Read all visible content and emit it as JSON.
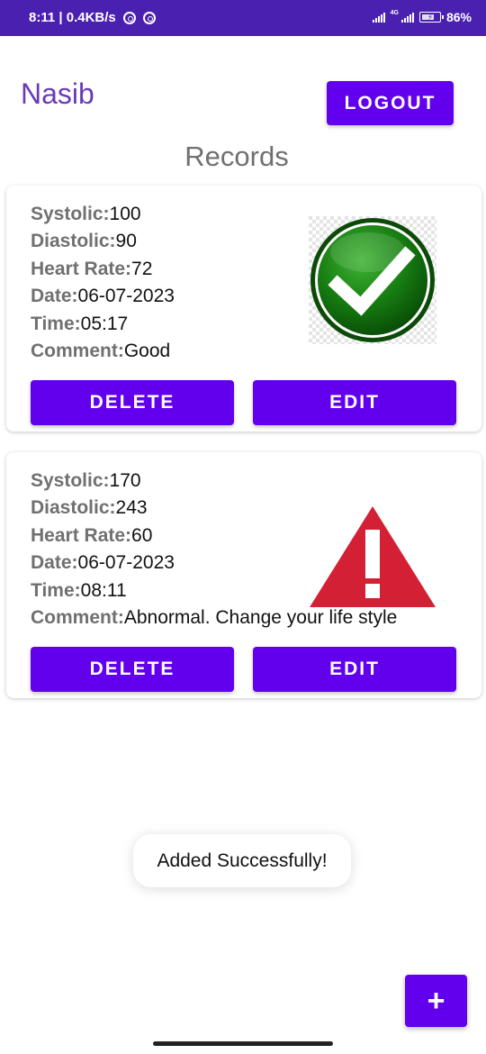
{
  "status_bar": {
    "time_speed": "8:11 | 0.4KB/s",
    "network": "4G",
    "battery": "86%"
  },
  "header": {
    "user_name": "Nasib",
    "logout_label": "LOGOUT"
  },
  "records_title": "Records",
  "records": [
    {
      "systolic_label": "Systolic:",
      "systolic": "100",
      "diastolic_label": "Diastolic:",
      "diastolic": "90",
      "heart_rate_label": "Heart Rate:",
      "heart_rate": "72",
      "date_label": "Date:",
      "date": "06-07-2023",
      "time_label": "Time:",
      "time": "05:17",
      "comment_label": "Comment:",
      "comment": "Good",
      "status_icon": "check-icon",
      "delete_label": "DELETE",
      "edit_label": "EDIT"
    },
    {
      "systolic_label": "Systolic:",
      "systolic": "170",
      "diastolic_label": "Diastolic:",
      "diastolic": "243",
      "heart_rate_label": "Heart Rate:",
      "heart_rate": "60",
      "date_label": "Date:",
      "date": "06-07-2023",
      "time_label": "Time:",
      "time": "08:11",
      "comment_label": "Comment:",
      "comment": "Abnormal. Change your life style",
      "status_icon": "warning-icon",
      "delete_label": "DELETE",
      "edit_label": "EDIT"
    }
  ],
  "toast": "Added Successfully!",
  "fab_label": "+",
  "colors": {
    "accent": "#6200ee",
    "status_bar": "#4a20b0",
    "user_name": "#6a3ab8",
    "label_gray": "#707070",
    "ok_green": "#1a7a0e",
    "warning_red": "#d42035"
  }
}
